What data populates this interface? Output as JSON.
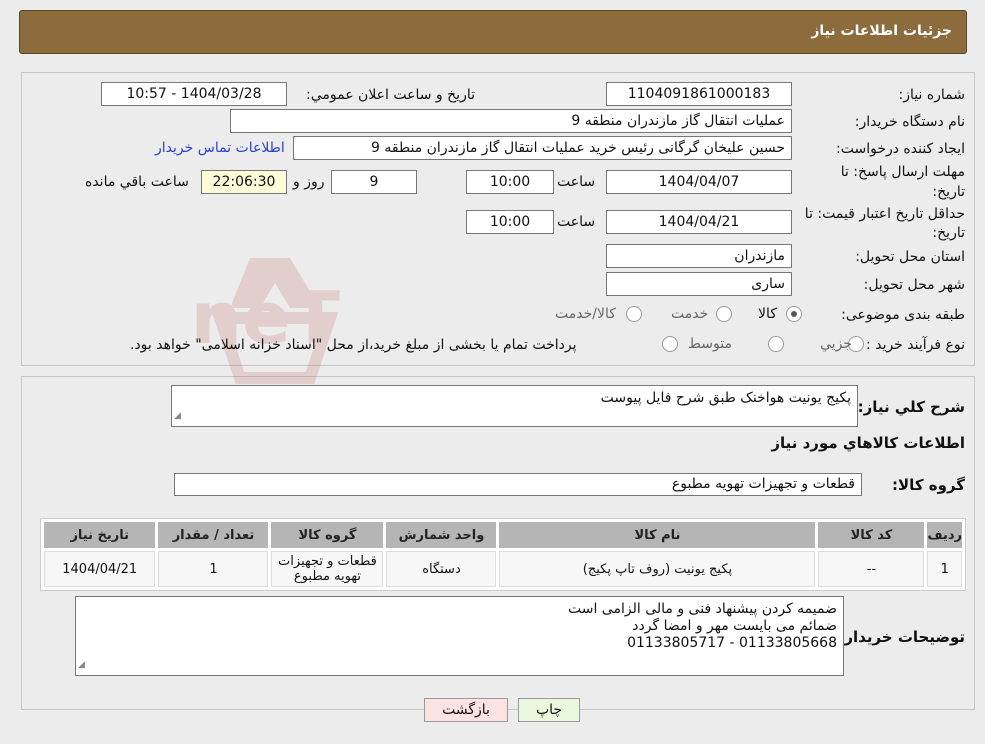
{
  "header": {
    "title": "جزئیات اطلاعات نیاز"
  },
  "form": {
    "need_number": {
      "label": "شماره نیاز:",
      "value": "1104091861000183"
    },
    "announce_datetime": {
      "label": "تاریخ و ساعت اعلان عمومي:",
      "value": "1404/03/28 - 10:57"
    },
    "buyer_org": {
      "label": "نام دستگاه خريدار:",
      "value": "عملیات انتقال گاز مازندران منطقه 9"
    },
    "requester": {
      "label": "ايجاد کننده درخواست:",
      "value": "حسین علیخان گرگانی رئیس خرید عملیات انتقال گاز مازندران منطقه 9",
      "contact_link": "اطلاعات تماس خريدار"
    },
    "reply_deadline": {
      "label_line1": "مهلت ارسال پاسخ: تا",
      "label_line2": "تاريخ:",
      "date": "1404/04/07",
      "time_label": "ساعت",
      "time": "10:00",
      "days": "9",
      "days_label": "روز و",
      "remaining": "22:06:30",
      "remaining_label": "ساعت باقي مانده"
    },
    "price_validity": {
      "label_line1": "حداقل تاريخ اعتبار قيمت: تا",
      "label_line2": "تاريخ:",
      "date": "1404/04/21",
      "time_label": "ساعت",
      "time": "10:00"
    },
    "province": {
      "label": "استان محل تحويل:",
      "value": "مازندران"
    },
    "city": {
      "label": "شهر محل تحويل:",
      "value": "ساری"
    },
    "category": {
      "label": "طبقه بندی موضوعی:",
      "options": [
        "کالا",
        "خدمت",
        "کالا/خدمت"
      ],
      "selected": 0
    },
    "purchase_process": {
      "label": "نوع فرآيند خريد :",
      "options": [
        "جزيي",
        "متوسط"
      ],
      "note": "پرداخت تمام يا بخشی از مبلغ خريد،از محل \"اسناد خزانه اسلامی\" خواهد بود."
    }
  },
  "summary": {
    "label": "شرح کلي نياز:",
    "value": "پکیج یونیت هواخنک طبق شرح فایل پیوست"
  },
  "goods_section": {
    "title": "اطلاعات کالاهاي مورد نياز"
  },
  "goods_group": {
    "label": "گروه کالا:",
    "value": "قطعات و تجهیزات تهویه مطبوع"
  },
  "table": {
    "headers": [
      "رديف",
      "کد کالا",
      "نام کالا",
      "واحد شمارش",
      "گروه کالا",
      "تعداد / مقدار",
      "تاريخ نياز"
    ],
    "rows": [
      [
        "1",
        "--",
        "پکیج یونیت (روف تاپ پکیج)",
        "دستگاه",
        "قطعات و تجهیزات تهویه مطبوع",
        "1",
        "1404/04/21"
      ]
    ]
  },
  "buyer_notes": {
    "label": "توضيحات خريدار:",
    "lines": [
      "ضمیمه کردن پیشنهاد فنی و مالی الزامی است",
      "ضمائم می بایست مهر و امضا گردد",
      "01133805668 - 01133805717"
    ]
  },
  "buttons": {
    "print": "چاپ",
    "back": "بازگشت"
  },
  "watermark": {
    "text": "AriaTender.neT"
  },
  "colors": {
    "header_bg": "#8c6c3c",
    "link": "#2b3fd4",
    "print_btn": "#e9f7de",
    "back_btn": "#fde2e2"
  }
}
